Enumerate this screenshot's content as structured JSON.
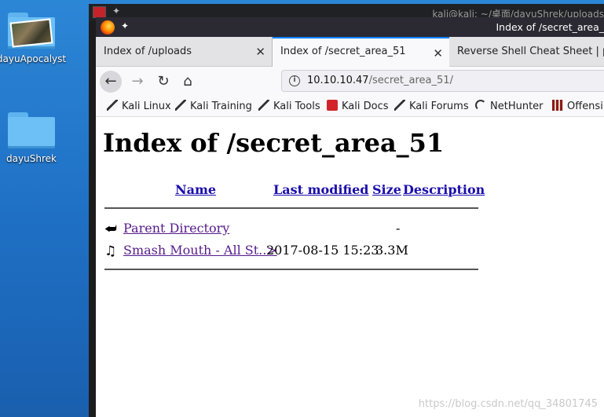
{
  "desktop": {
    "icons": [
      {
        "label": "dayuApocalyst"
      },
      {
        "label": "dayuShrek"
      }
    ]
  },
  "terminal": {
    "title": "kali@kali: ~/桌面/dayuShrek/uploads"
  },
  "browser": {
    "window_title": "Index of /secret_area_",
    "tabs": [
      {
        "label": "Index of /uploads",
        "close": "✕"
      },
      {
        "label": "Index of /secret_area_51",
        "close": "✕"
      },
      {
        "label": "Reverse Shell Cheat Sheet | pe",
        "close": ""
      }
    ],
    "url": {
      "host": "10.10.10.47",
      "path": "/secret_area_51/"
    },
    "bookmarks": [
      {
        "label": "Kali Linux",
        "icon": "dragon-icon"
      },
      {
        "label": "Kali Training",
        "icon": "dragon-icon"
      },
      {
        "label": "Kali Tools",
        "icon": "dragon-icon"
      },
      {
        "label": "Kali Docs",
        "icon": "docs-icon"
      },
      {
        "label": "Kali Forums",
        "icon": "dragon-icon"
      },
      {
        "label": "NetHunter",
        "icon": "nethunter-icon"
      },
      {
        "label": "Offensi",
        "icon": "offsec-icon"
      }
    ]
  },
  "page": {
    "title": "Index of /secret_area_51",
    "columns": {
      "name": "Name",
      "last_modified": "Last modified",
      "size": "Size",
      "description": "Description"
    },
    "rows": [
      {
        "name": "Parent Directory",
        "date": "",
        "size": "-",
        "icon": "back-arrow-icon"
      },
      {
        "name": "Smash Mouth - All St..>",
        "date": "2017-08-15 15:23",
        "size": "3.3M",
        "icon": "music-note-icon"
      }
    ]
  },
  "watermark": "https://blog.csdn.net/qq_34801745",
  "colors": {
    "link": "#1a0dab",
    "visited": "#551a8b",
    "tab_accent": "#0a84ff",
    "desktop": "#2c86d6"
  }
}
